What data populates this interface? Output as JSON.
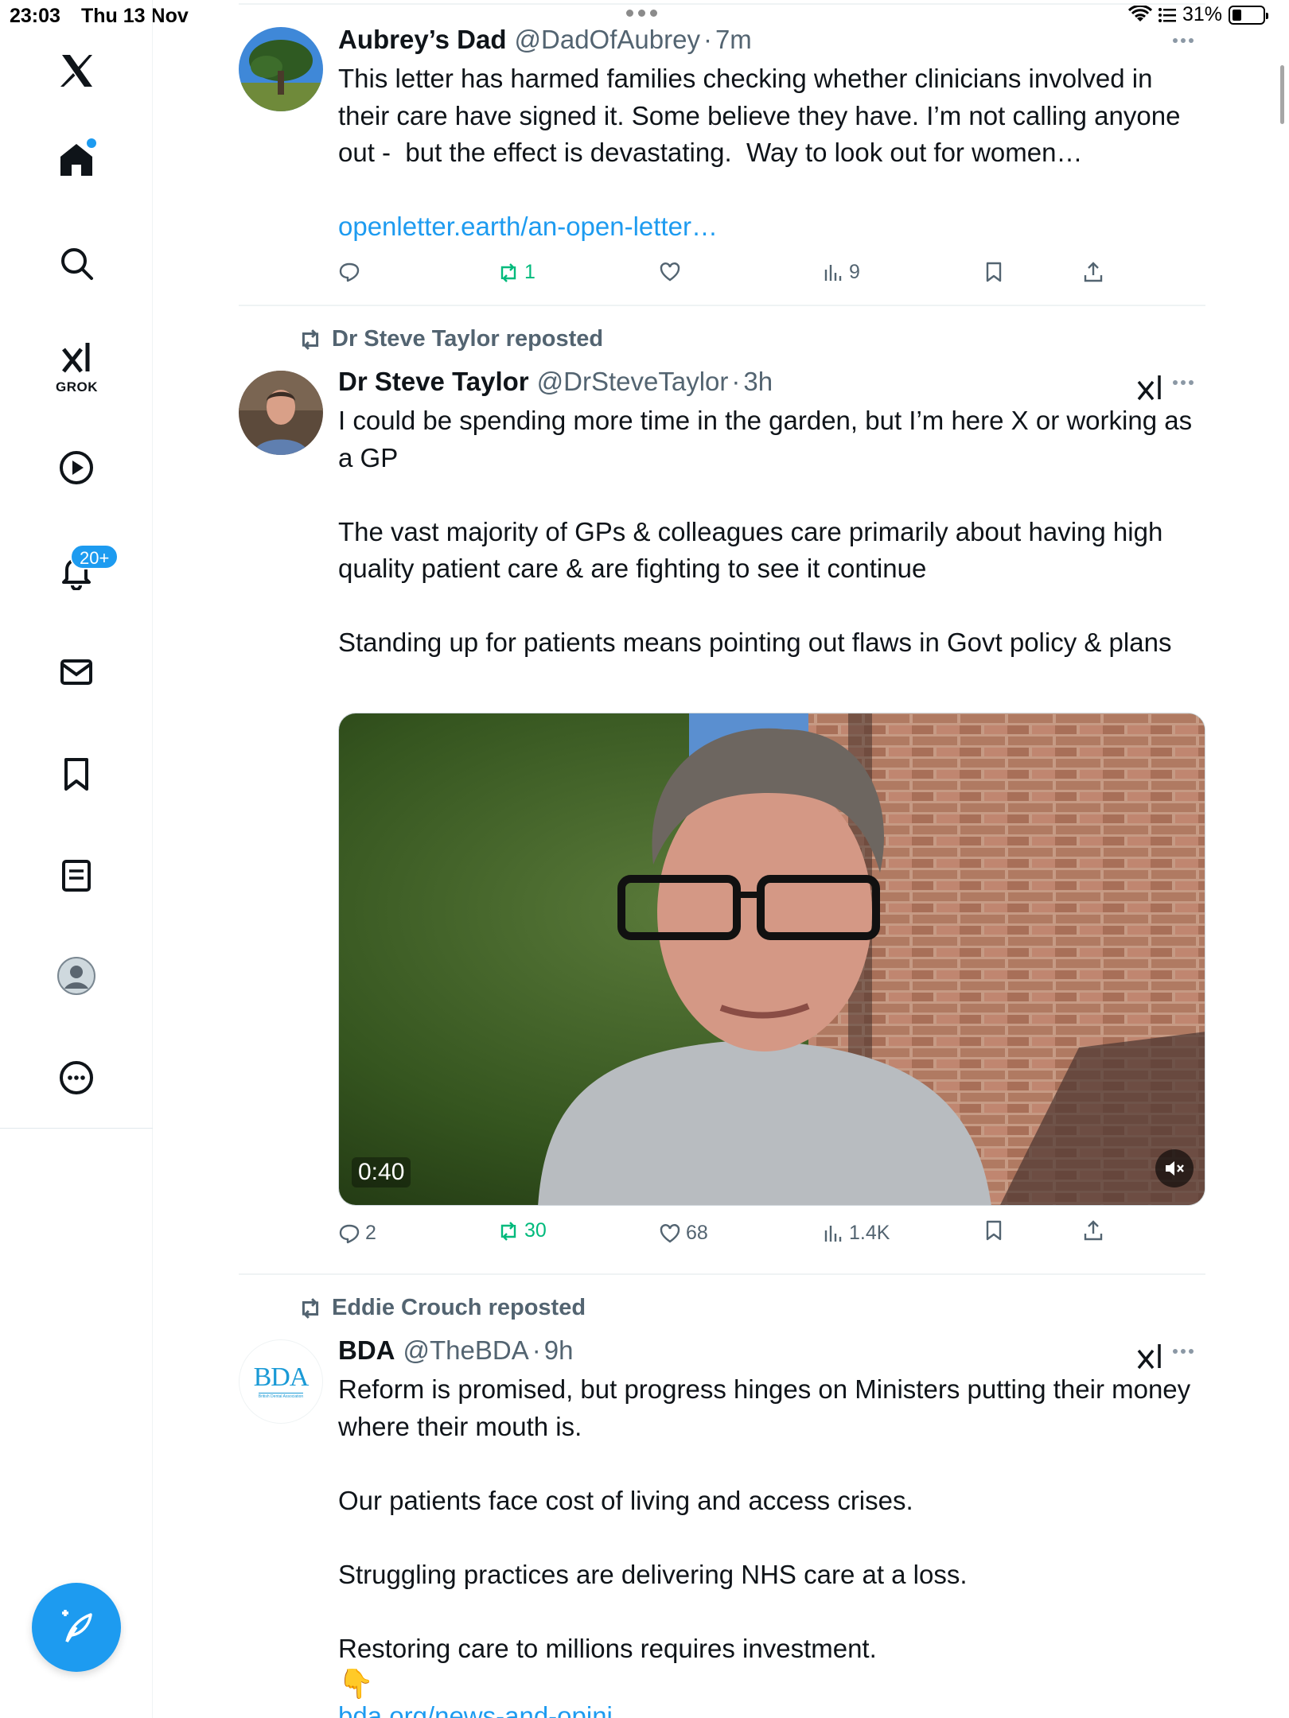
{
  "status_bar": {
    "time": "23:03",
    "date": "Thu 13 Nov",
    "battery": "31%",
    "battery_level": 0.31
  },
  "sidebar": {
    "grok_label": "GROK",
    "notifications_badge": "20+",
    "items": [
      "x-logo",
      "home",
      "search",
      "grok",
      "video",
      "notifications",
      "messages",
      "bookmarks",
      "lists",
      "profile",
      "more"
    ]
  },
  "tweets": [
    {
      "name": "Aubrey’s Dad",
      "handle": "@DadOfAubrey",
      "dot": "·",
      "time": "7m",
      "text": "This letter has harmed families checking whether clinicians involved in their care have signed it. Some believe they have. I’m not calling anyone out -  but the effect is devastating.  Way to look out for women…",
      "link": "openletter.earth/an-open-letter…",
      "replies": "",
      "reposts": "1",
      "likes": "",
      "views": "9"
    },
    {
      "reposted_by": "Dr Steve Taylor reposted",
      "name": "Dr Steve Taylor",
      "handle": "@DrSteveTaylor",
      "dot": "·",
      "time": "3h",
      "text": "I could be spending more time in the garden, but I’m here X or working as a GP\n\nThe vast majority of GPs & colleagues care primarily about having high quality patient care & are fighting to see it continue\n\nStanding up for patients means pointing out flaws in Govt policy & plans",
      "video_duration": "0:40",
      "replies": "2",
      "reposts": "30",
      "likes": "68",
      "views": "1.4K"
    },
    {
      "reposted_by": "Eddie Crouch reposted",
      "name": "BDA",
      "handle": "@TheBDA",
      "dot": "·",
      "time": "9h",
      "avatar_text": "BDA",
      "avatar_subtext": "British Dental Association",
      "text": "Reform is promised, but progress hinges on Ministers putting their money where their mouth is.\n\nOur patients face cost of living and access crises.\n\nStruggling practices are delivering NHS care at a loss.\n\nRestoring care to millions requires investment.",
      "emoji": "👇",
      "link_partial": "bda.org/news-and-opini..."
    }
  ],
  "colors": {
    "accent": "#1d9bf0",
    "repost_green": "#00ba7c",
    "secondary_text": "#536471",
    "divider": "#eff3f4"
  }
}
